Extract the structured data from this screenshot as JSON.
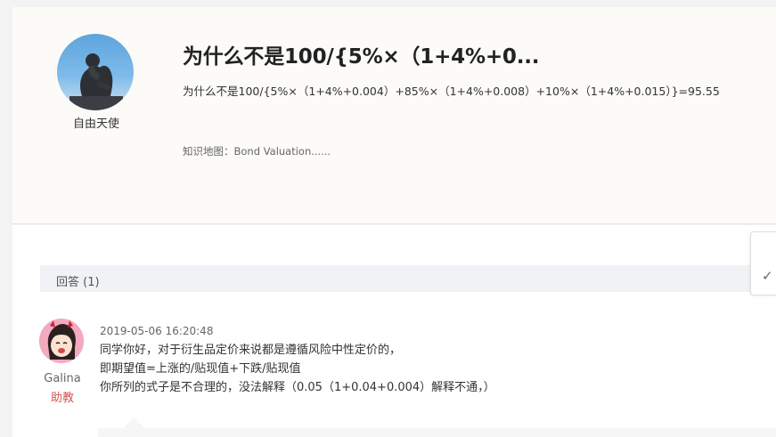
{
  "question": {
    "asker_name": "自由天使",
    "title": "为什么不是100/{5%×（1+4%+0...",
    "body": "为什么不是100/{5%×（1+4%+0.004）+85%×（1+4%+0.008）+10%×（1+4%+0.015）}=95.55",
    "knowledge_map": "知识地图：Bond Valuation......"
  },
  "answers": {
    "header": "回答 (1)",
    "items": [
      {
        "author": "Galina",
        "role": "助教",
        "time": "2019-05-06 16:20:48",
        "lines": [
          "同学你好，对于衍生品定价来说都是遵循风险中性定价的，",
          "即期望值=上涨的/贴现值+下跌/贴现值",
          "你所列的式子是不合理的，没法解释（0.05（1+0.04+0.004）解释不通，）"
        ]
      }
    ]
  },
  "side_tab": {
    "icon": "check-icon",
    "glyph": "✓"
  },
  "colors": {
    "role": "#d9534f",
    "card_bg": "#fcfbf8",
    "header_bg": "#f1f2f6"
  }
}
